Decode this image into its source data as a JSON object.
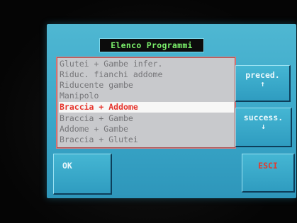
{
  "window": {
    "title": "Elenco Programmi"
  },
  "program_list": {
    "items": [
      "Glutei + Gambe infer.",
      "Riduc. fianchi addome",
      "Riducente gambe",
      "Manipolo",
      "Braccia + Addome",
      "Braccia + Gambe",
      "Addome + Gambe",
      "Braccia + Glutei"
    ],
    "selected_index": 4
  },
  "buttons": {
    "previous_label": "preced.",
    "previous_arrow": "↑",
    "next_label": "success.",
    "next_arrow": "↓",
    "ok_label": "OK",
    "exit_label": "ESCI"
  },
  "colors": {
    "screen_bg": "#3aa7c9",
    "title_text": "#7bf06b",
    "selected_text": "#e6352d",
    "list_text": "#767679",
    "exit_text": "#e23b2e"
  },
  "icons": {
    "previous": "arrow-up-icon",
    "next": "arrow-down-icon"
  }
}
